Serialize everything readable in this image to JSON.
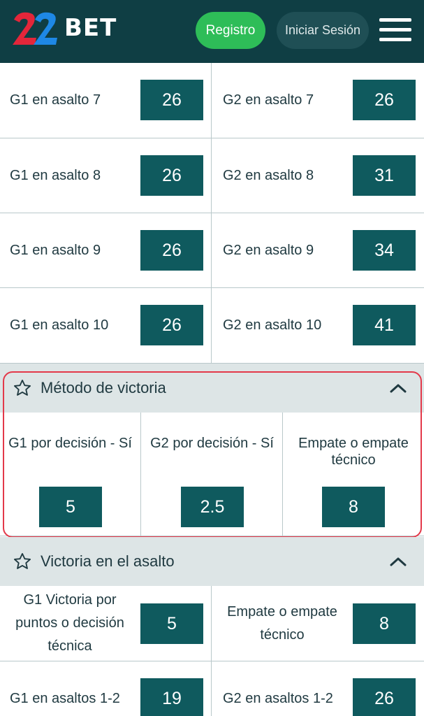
{
  "header": {
    "logo_number": "22",
    "logo_text": "BET",
    "register_label": "Registro",
    "login_label": "Iniciar Sesión"
  },
  "rounds": [
    {
      "left_label": "G1 en asalto 7",
      "left_odd": "26",
      "right_label": "G2 en asalto 7",
      "right_odd": "26"
    },
    {
      "left_label": "G1 en asalto 8",
      "left_odd": "26",
      "right_label": "G2 en asalto 8",
      "right_odd": "31"
    },
    {
      "left_label": "G1 en asalto 9",
      "left_odd": "26",
      "right_label": "G2 en asalto 9",
      "right_odd": "34"
    },
    {
      "left_label": "G1 en asalto 10",
      "left_odd": "26",
      "right_label": "G2 en asalto 10",
      "right_odd": "41"
    }
  ],
  "method": {
    "title": "Método de victoria",
    "options": [
      {
        "label": "G1 por decisión - Sí",
        "odd": "5"
      },
      {
        "label": "G2 por decisión - Sí",
        "odd": "2.5"
      },
      {
        "label": "Empate o empate técnico",
        "odd": "8"
      }
    ]
  },
  "round_victory": {
    "title": "Victoria en el asalto",
    "rows": [
      {
        "left_label": "G1 Victoria por puntos o decisión técnica",
        "left_odd": "5",
        "right_label": "Empate o empate técnico",
        "right_odd": "8"
      },
      {
        "left_label": "G1 en asaltos 1-2",
        "left_odd": "19",
        "right_label": "G2 en asaltos 1-2",
        "right_odd": "26"
      }
    ]
  },
  "colors": {
    "header_bg": "#0f3e44",
    "register_bg": "#2ebd58",
    "odd_bg": "#0f5a5e",
    "highlight": "#e3394a"
  }
}
